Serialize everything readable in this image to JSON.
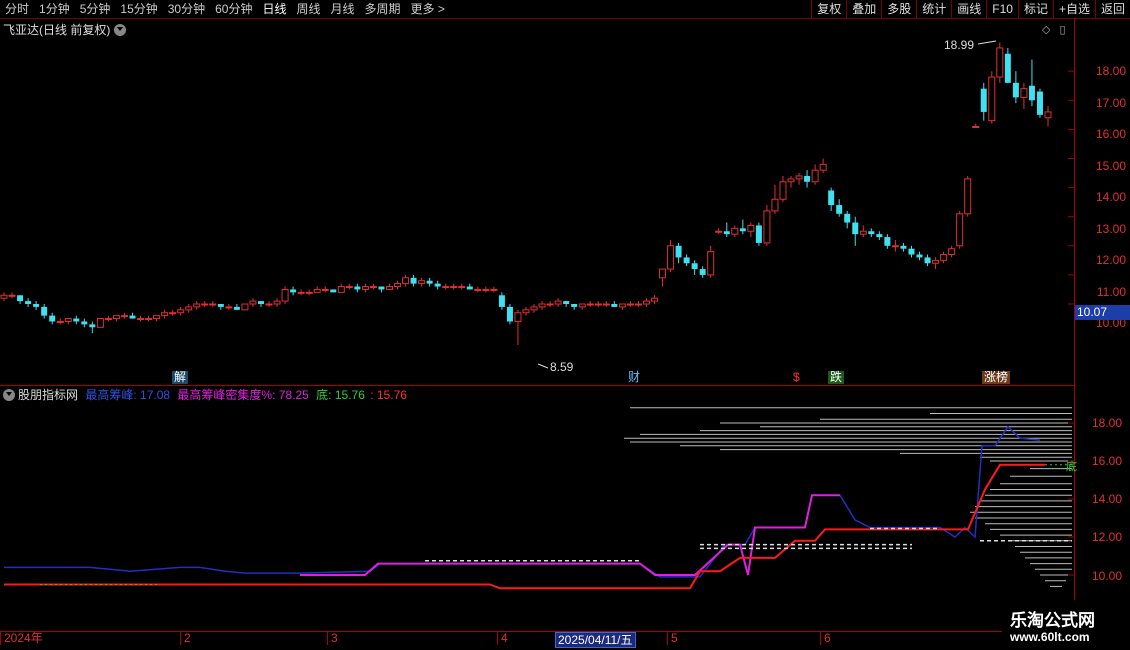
{
  "toolbar": {
    "periods": [
      "分时",
      "1分钟",
      "5分钟",
      "15分钟",
      "30分钟",
      "60分钟",
      "日线",
      "周线",
      "月线",
      "多周期",
      "更多 >"
    ],
    "tools": [
      "复权",
      "叠加",
      "多股",
      "统计",
      "画线",
      "F10",
      "标记",
      "+自选",
      "返回"
    ]
  },
  "main_pane": {
    "title": "飞亚达(日线 前复权)",
    "current_price": "10.07",
    "high_label": "18.99",
    "low_label": "8.59",
    "price_axis": [
      "18.00",
      "17.00",
      "16.00",
      "15.00",
      "14.00",
      "13.00",
      "12.00",
      "11.00",
      "10.00"
    ],
    "markers": {
      "jie": "解",
      "cai": "财",
      "dollar": "$",
      "die": "跌",
      "zhangbang": "涨榜"
    }
  },
  "indicator_pane": {
    "name": "股朋指标网",
    "highest_peak_label": "最高筹峰:",
    "highest_peak_value": "17.08",
    "density_label": "最高筹峰密集度%:",
    "density_value": "78.25",
    "bottom_label": "底:",
    "bottom_value": "15.76",
    "extra_value": ": 15.76",
    "right_tag": "底",
    "axis": [
      "18.00",
      "16.00",
      "14.00",
      "12.00",
      "10.00"
    ]
  },
  "date_axis": {
    "ticks": [
      "2024年",
      "2",
      "3",
      "4",
      "5",
      "6"
    ],
    "cursor_date": "2025/04/11/五"
  },
  "watermark": {
    "line1": "乐淘公式网",
    "line2": "www.60lt.com"
  },
  "colors": {
    "up": "#e03030",
    "down": "#40e0f0",
    "peak_line": "#2030c0",
    "density_line": "#e020e0",
    "bottom_line": "#ff1a1a",
    "axis": "#a00000"
  },
  "chart_data": {
    "type": "candlestick",
    "ylim": [
      8.0,
      19.5
    ],
    "candles": [
      [
        10.2,
        10.4,
        10.1,
        10.3
      ],
      [
        10.3,
        10.4,
        10.2,
        10.3
      ],
      [
        10.3,
        10.3,
        10.0,
        10.1
      ],
      [
        10.1,
        10.2,
        9.9,
        10.0
      ],
      [
        10.0,
        10.1,
        9.8,
        9.9
      ],
      [
        9.9,
        10.0,
        9.5,
        9.6
      ],
      [
        9.6,
        9.7,
        9.3,
        9.4
      ],
      [
        9.4,
        9.5,
        9.3,
        9.4
      ],
      [
        9.4,
        9.5,
        9.3,
        9.5
      ],
      [
        9.5,
        9.6,
        9.3,
        9.4
      ],
      [
        9.4,
        9.5,
        9.2,
        9.3
      ],
      [
        9.3,
        9.4,
        9.0,
        9.2
      ],
      [
        9.2,
        9.5,
        9.2,
        9.5
      ],
      [
        9.5,
        9.6,
        9.4,
        9.5
      ],
      [
        9.5,
        9.6,
        9.4,
        9.6
      ],
      [
        9.6,
        9.7,
        9.5,
        9.6
      ],
      [
        9.6,
        9.7,
        9.5,
        9.5
      ],
      [
        9.5,
        9.6,
        9.4,
        9.5
      ],
      [
        9.5,
        9.6,
        9.4,
        9.5
      ],
      [
        9.5,
        9.6,
        9.4,
        9.6
      ],
      [
        9.6,
        9.8,
        9.5,
        9.7
      ],
      [
        9.7,
        9.8,
        9.6,
        9.7
      ],
      [
        9.7,
        9.9,
        9.6,
        9.8
      ],
      [
        9.8,
        10.0,
        9.7,
        9.9
      ],
      [
        9.9,
        10.1,
        9.8,
        10.0
      ],
      [
        10.0,
        10.1,
        9.9,
        10.0
      ],
      [
        10.0,
        10.1,
        9.9,
        10.0
      ],
      [
        10.0,
        10.0,
        9.8,
        9.9
      ],
      [
        9.9,
        10.0,
        9.8,
        9.9
      ],
      [
        9.9,
        10.0,
        9.8,
        9.8
      ],
      [
        9.8,
        10.0,
        9.8,
        10.0
      ],
      [
        10.0,
        10.2,
        9.9,
        10.1
      ],
      [
        10.1,
        10.1,
        9.9,
        10.0
      ],
      [
        10.0,
        10.1,
        9.9,
        10.0
      ],
      [
        10.0,
        10.2,
        9.9,
        10.1
      ],
      [
        10.1,
        10.6,
        10.0,
        10.5
      ],
      [
        10.5,
        10.6,
        10.3,
        10.4
      ],
      [
        10.4,
        10.5,
        10.3,
        10.4
      ],
      [
        10.4,
        10.5,
        10.3,
        10.4
      ],
      [
        10.4,
        10.6,
        10.4,
        10.5
      ],
      [
        10.5,
        10.6,
        10.4,
        10.5
      ],
      [
        10.5,
        10.5,
        10.4,
        10.4
      ],
      [
        10.4,
        10.7,
        10.4,
        10.6
      ],
      [
        10.6,
        10.7,
        10.5,
        10.6
      ],
      [
        10.6,
        10.7,
        10.4,
        10.5
      ],
      [
        10.5,
        10.7,
        10.4,
        10.6
      ],
      [
        10.6,
        10.7,
        10.5,
        10.6
      ],
      [
        10.6,
        10.6,
        10.4,
        10.5
      ],
      [
        10.5,
        10.7,
        10.5,
        10.6
      ],
      [
        10.6,
        10.8,
        10.5,
        10.7
      ],
      [
        10.7,
        11.0,
        10.6,
        10.9
      ],
      [
        10.9,
        11.0,
        10.6,
        10.7
      ],
      [
        10.7,
        10.9,
        10.6,
        10.8
      ],
      [
        10.8,
        10.9,
        10.6,
        10.7
      ],
      [
        10.7,
        10.8,
        10.5,
        10.6
      ],
      [
        10.6,
        10.7,
        10.5,
        10.6
      ],
      [
        10.6,
        10.7,
        10.5,
        10.6
      ],
      [
        10.6,
        10.7,
        10.5,
        10.6
      ],
      [
        10.6,
        10.7,
        10.5,
        10.5
      ],
      [
        10.5,
        10.6,
        10.4,
        10.5
      ],
      [
        10.5,
        10.6,
        10.4,
        10.5
      ],
      [
        10.5,
        10.6,
        10.4,
        10.5
      ],
      [
        10.3,
        10.4,
        9.8,
        9.9
      ],
      [
        9.9,
        10.0,
        9.3,
        9.4
      ],
      [
        9.4,
        9.8,
        8.59,
        9.7
      ],
      [
        9.7,
        9.9,
        9.6,
        9.8
      ],
      [
        9.8,
        10.0,
        9.7,
        9.9
      ],
      [
        9.9,
        10.1,
        9.8,
        10.0
      ],
      [
        10.0,
        10.1,
        9.9,
        10.0
      ],
      [
        10.0,
        10.2,
        9.9,
        10.1
      ],
      [
        10.1,
        10.1,
        9.9,
        10.0
      ],
      [
        10.0,
        10.0,
        9.8,
        9.9
      ],
      [
        9.9,
        10.0,
        9.8,
        10.0
      ],
      [
        10.0,
        10.1,
        9.9,
        10.0
      ],
      [
        10.0,
        10.1,
        9.9,
        10.0
      ],
      [
        10.0,
        10.1,
        9.9,
        10.0
      ],
      [
        10.0,
        10.1,
        9.9,
        9.9
      ],
      [
        9.9,
        10.0,
        9.8,
        10.0
      ],
      [
        10.0,
        10.1,
        9.9,
        10.0
      ],
      [
        10.0,
        10.1,
        9.9,
        10.0
      ],
      [
        10.0,
        10.2,
        9.9,
        10.1
      ],
      [
        10.1,
        10.3,
        10.0,
        10.2
      ],
      [
        10.9,
        11.0,
        10.6,
        11.2
      ],
      [
        11.2,
        12.2,
        11.1,
        12.0
      ],
      [
        12.0,
        12.1,
        11.4,
        11.6
      ],
      [
        11.6,
        11.7,
        11.3,
        11.4
      ],
      [
        11.4,
        11.5,
        11.0,
        11.2
      ],
      [
        11.2,
        11.3,
        10.9,
        11.0
      ],
      [
        11.0,
        12.0,
        10.9,
        11.8
      ],
      [
        12.5,
        12.6,
        12.4,
        12.5
      ],
      [
        12.5,
        12.8,
        12.3,
        12.4
      ],
      [
        12.4,
        12.7,
        12.3,
        12.6
      ],
      [
        12.6,
        12.9,
        12.4,
        12.5
      ],
      [
        12.5,
        12.8,
        12.3,
        12.7
      ],
      [
        12.7,
        12.8,
        12.0,
        12.1
      ],
      [
        12.1,
        13.4,
        12.0,
        13.2
      ],
      [
        13.2,
        14.1,
        13.1,
        13.6
      ],
      [
        13.6,
        14.4,
        13.5,
        14.2
      ],
      [
        14.2,
        14.4,
        14.0,
        14.3
      ],
      [
        14.3,
        14.5,
        14.1,
        14.4
      ],
      [
        14.4,
        14.6,
        14.0,
        14.2
      ],
      [
        14.2,
        14.8,
        14.1,
        14.6
      ],
      [
        14.6,
        15.0,
        14.5,
        14.8
      ],
      [
        13.9,
        14.0,
        13.2,
        13.4
      ],
      [
        13.4,
        13.6,
        13.0,
        13.1
      ],
      [
        13.1,
        13.2,
        12.6,
        12.8
      ],
      [
        12.8,
        13.0,
        12.0,
        12.4
      ],
      [
        12.4,
        12.7,
        12.3,
        12.5
      ],
      [
        12.5,
        12.6,
        12.3,
        12.4
      ],
      [
        12.4,
        12.5,
        12.2,
        12.3
      ],
      [
        12.3,
        12.4,
        11.9,
        12.0
      ],
      [
        12.0,
        12.2,
        11.8,
        12.0
      ],
      [
        12.0,
        12.1,
        11.8,
        11.9
      ],
      [
        11.9,
        12.0,
        11.6,
        11.7
      ],
      [
        11.7,
        11.8,
        11.5,
        11.6
      ],
      [
        11.6,
        11.7,
        11.3,
        11.4
      ],
      [
        11.4,
        11.6,
        11.2,
        11.5
      ],
      [
        11.5,
        11.8,
        11.4,
        11.7
      ],
      [
        11.7,
        12.0,
        11.6,
        11.9
      ],
      [
        12.0,
        13.2,
        11.9,
        13.1
      ],
      [
        13.1,
        14.4,
        13.0,
        14.3
      ],
      [
        16.1,
        16.2,
        16.1,
        16.1
      ],
      [
        17.4,
        17.6,
        16.3,
        16.6
      ],
      [
        16.3,
        18.0,
        16.2,
        17.8
      ],
      [
        17.8,
        18.99,
        17.6,
        18.8
      ],
      [
        18.6,
        18.8,
        17.6,
        17.6
      ],
      [
        17.6,
        18.0,
        16.9,
        17.1
      ],
      [
        17.1,
        17.6,
        16.7,
        17.4
      ],
      [
        17.5,
        18.4,
        16.8,
        17.0
      ],
      [
        17.3,
        17.4,
        16.4,
        16.5
      ],
      [
        16.4,
        16.8,
        16.1,
        16.6
      ]
    ],
    "indicator_series": {
      "highest_peak": 17.08,
      "density_percent": 78.25,
      "bottom": 15.76
    }
  }
}
